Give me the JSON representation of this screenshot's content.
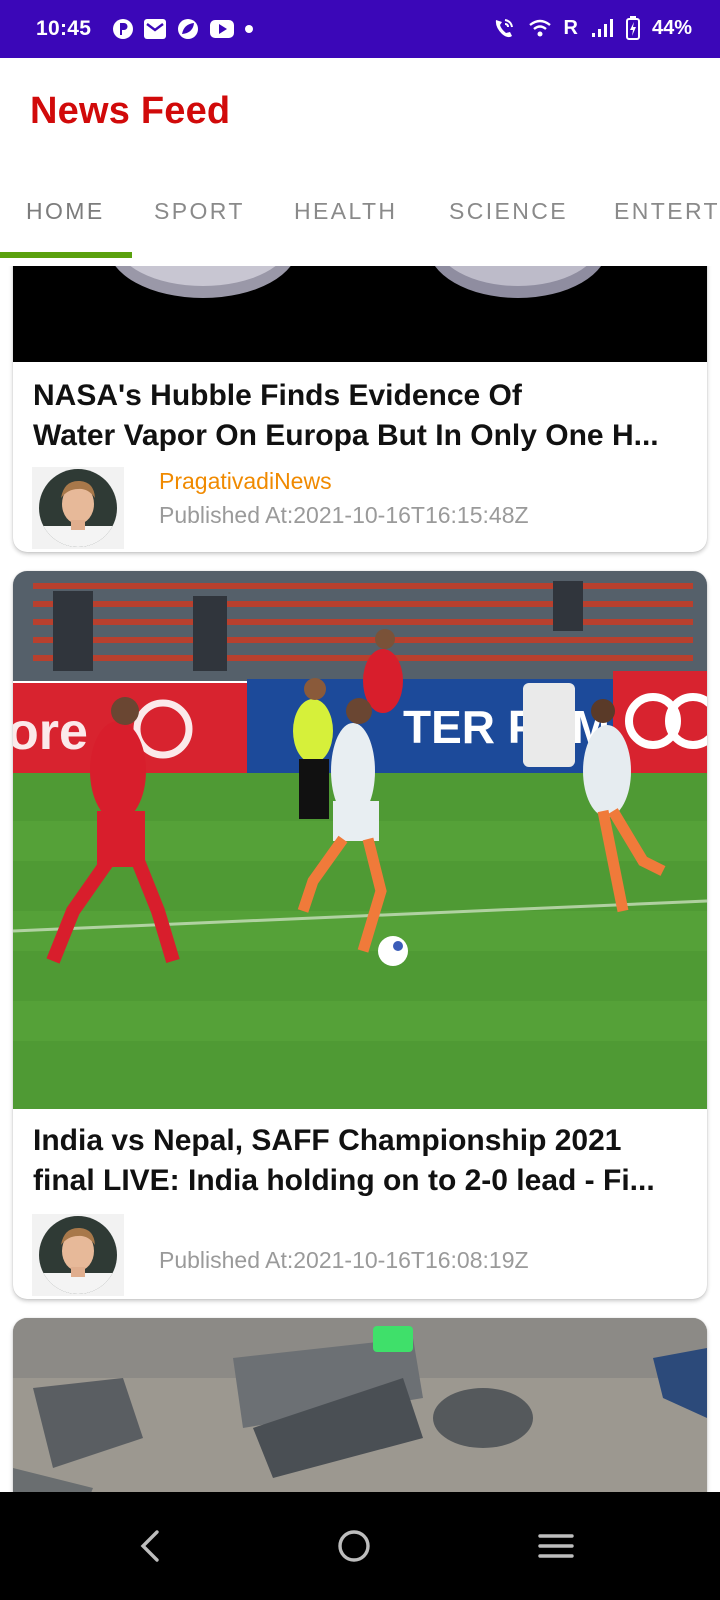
{
  "status_bar": {
    "time": "10:45",
    "left_icons": [
      "p-circle-icon",
      "mail-icon",
      "leaf-icon",
      "youtube-icon",
      "dot-icon"
    ],
    "right_icons": [
      "wifi-call-icon",
      "wifi-icon",
      "signal-icon",
      "battery-icon"
    ],
    "roaming": "R",
    "battery": "44%",
    "background": "#3b07b8"
  },
  "app_bar": {
    "title": "News Feed",
    "title_color": "#d10a0a"
  },
  "tabs": [
    {
      "label": "HOME",
      "selected": true
    },
    {
      "label": "SPORT",
      "selected": false
    },
    {
      "label": "HEALTH",
      "selected": false
    },
    {
      "label": "SCIENCE",
      "selected": false
    },
    {
      "label": "ENTERT",
      "selected": false
    }
  ],
  "tab_indicator_color": "#5aa10e",
  "feed": {
    "items": [
      {
        "title_line1": "NASA's Hubble Finds Evidence Of",
        "title_line2": "Water Vapor On Europa But In Only One H...",
        "source": "PragativadiNews",
        "published": "Published At:2021-10-16T16:15:48Z",
        "image": "space-planets-image"
      },
      {
        "title_line1": "India vs Nepal, SAFF Championship 2021",
        "title_line2": "final LIVE: India holding on to 2-0 lead - Fi...",
        "source": "",
        "published": "Published At:2021-10-16T16:08:19Z",
        "image": "football-match-image",
        "board_text": "TER PUMPS"
      },
      {
        "image": "debris-image"
      }
    ],
    "source_color": "#f08a00"
  },
  "nav_bar": {
    "buttons": [
      "back-icon",
      "home-icon",
      "recents-icon"
    ]
  }
}
